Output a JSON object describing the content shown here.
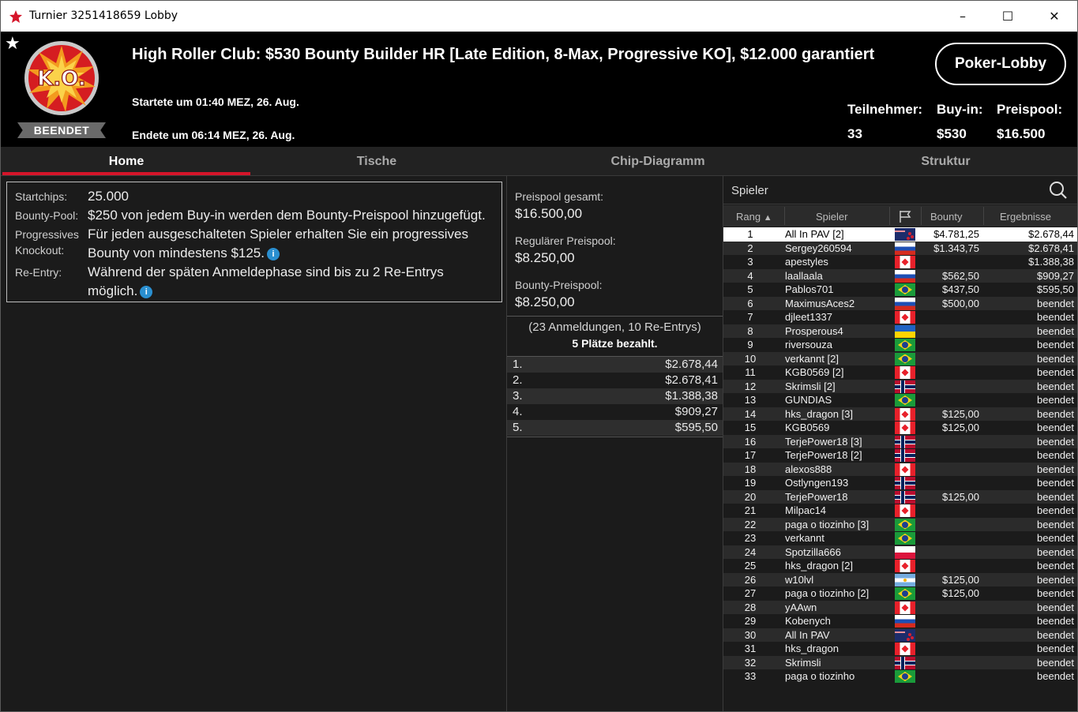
{
  "window": {
    "title": "Turnier 3251418659 Lobby",
    "minimize": "–",
    "maximize": "☐",
    "close": "✕"
  },
  "header": {
    "title": "High Roller Club: $530 Bounty Builder HR [Late Edition, 8-Max, Progressive KO], $12.000 garantiert",
    "logo_text": "K.O.",
    "status": "BEENDET",
    "started": "Startete um 01:40 MEZ, 26. Aug.",
    "ended": "Endete um 06:14 MEZ, 26. Aug.",
    "lobby_button": "Poker-Lobby",
    "stats": {
      "participants_label": "Teilnehmer:",
      "participants_value": "33",
      "buyin_label": "Buy-in:",
      "buyin_value": "$530",
      "prizepool_label": "Preispool:",
      "prizepool_value": "$16.500"
    }
  },
  "tabs": [
    {
      "label": "Home",
      "active": true
    },
    {
      "label": "Tische",
      "active": false
    },
    {
      "label": "Chip-Diagramm",
      "active": false
    },
    {
      "label": "Struktur",
      "active": false
    }
  ],
  "info": {
    "startchips_label": "Startchips:",
    "startchips_value": "25.000",
    "bountypool_label": "Bounty-Pool:",
    "bountypool_value": "$250 von jedem Buy-in werden dem Bounty-Preispool hinzugefügt.",
    "pko_label_1": "Progressives",
    "pko_label_2": "Knockout:",
    "pko_value_1": "Für jeden ausgeschalteten Spieler erhalten Sie ein progressives",
    "pko_value_2": "Bounty von mindestens $125.",
    "reentry_label": "Re-Entry:",
    "reentry_value_1": "Während der späten Anmeldephase sind bis zu 2 Re-Entrys",
    "reentry_value_2": "möglich."
  },
  "prize": {
    "total_label": "Preispool gesamt:",
    "total_value": "$16.500,00",
    "regular_label": "Regulärer Preispool:",
    "regular_value": "$8.250,00",
    "bounty_label": "Bounty-Preispool:",
    "bounty_value": "$8.250,00",
    "entries": "(23 Anmeldungen, 10 Re-Entrys)",
    "paid": "5 Plätze bezahlt.",
    "payouts": [
      {
        "place": "1.",
        "amount": "$2.678,44"
      },
      {
        "place": "2.",
        "amount": "$2.678,41"
      },
      {
        "place": "3.",
        "amount": "$1.388,38"
      },
      {
        "place": "4.",
        "amount": "$909,27"
      },
      {
        "place": "5.",
        "amount": "$595,50"
      }
    ]
  },
  "players": {
    "search_label": "Spieler",
    "columns": {
      "rank": "Rang",
      "player": "Spieler",
      "bounty": "Bounty",
      "result": "Ergebnisse"
    },
    "rows": [
      {
        "rank": "1",
        "name": "All In PAV [2]",
        "flag": "nz",
        "bounty": "$4.781,25",
        "result": "$2.678,44"
      },
      {
        "rank": "2",
        "name": "Sergey260594",
        "flag": "ru",
        "bounty": "$1.343,75",
        "result": "$2.678,41"
      },
      {
        "rank": "3",
        "name": "apestyles",
        "flag": "ca",
        "bounty": "",
        "result": "$1.388,38"
      },
      {
        "rank": "4",
        "name": "laallaala",
        "flag": "ru",
        "bounty": "$562,50",
        "result": "$909,27"
      },
      {
        "rank": "5",
        "name": "Pablos701",
        "flag": "br",
        "bounty": "$437,50",
        "result": "$595,50"
      },
      {
        "rank": "6",
        "name": "MaximusAces2",
        "flag": "ru",
        "bounty": "$500,00",
        "result": "beendet"
      },
      {
        "rank": "7",
        "name": "djleet1337",
        "flag": "ca",
        "bounty": "",
        "result": "beendet"
      },
      {
        "rank": "8",
        "name": "Prosperous4",
        "flag": "ua",
        "bounty": "",
        "result": "beendet"
      },
      {
        "rank": "9",
        "name": "riversouza",
        "flag": "br",
        "bounty": "",
        "result": "beendet"
      },
      {
        "rank": "10",
        "name": "verkannt [2]",
        "flag": "br",
        "bounty": "",
        "result": "beendet"
      },
      {
        "rank": "11",
        "name": "KGB0569 [2]",
        "flag": "ca",
        "bounty": "",
        "result": "beendet"
      },
      {
        "rank": "12",
        "name": "Skrimsli [2]",
        "flag": "no",
        "bounty": "",
        "result": "beendet"
      },
      {
        "rank": "13",
        "name": "GUNDIAS",
        "flag": "br",
        "bounty": "",
        "result": "beendet"
      },
      {
        "rank": "14",
        "name": "hks_dragon [3]",
        "flag": "ca",
        "bounty": "$125,00",
        "result": "beendet"
      },
      {
        "rank": "15",
        "name": "KGB0569",
        "flag": "ca",
        "bounty": "$125,00",
        "result": "beendet"
      },
      {
        "rank": "16",
        "name": "TerjePower18 [3]",
        "flag": "no",
        "bounty": "",
        "result": "beendet"
      },
      {
        "rank": "17",
        "name": "TerjePower18 [2]",
        "flag": "no",
        "bounty": "",
        "result": "beendet"
      },
      {
        "rank": "18",
        "name": "alexos888",
        "flag": "ca",
        "bounty": "",
        "result": "beendet"
      },
      {
        "rank": "19",
        "name": "Ostlyngen193",
        "flag": "no",
        "bounty": "",
        "result": "beendet"
      },
      {
        "rank": "20",
        "name": "TerjePower18",
        "flag": "no",
        "bounty": "$125,00",
        "result": "beendet"
      },
      {
        "rank": "21",
        "name": "Milpac14",
        "flag": "ca",
        "bounty": "",
        "result": "beendet"
      },
      {
        "rank": "22",
        "name": "paga o tiozinho [3]",
        "flag": "br",
        "bounty": "",
        "result": "beendet"
      },
      {
        "rank": "23",
        "name": "verkannt",
        "flag": "br",
        "bounty": "",
        "result": "beendet"
      },
      {
        "rank": "24",
        "name": "Spotzilla666",
        "flag": "pl",
        "bounty": "",
        "result": "beendet"
      },
      {
        "rank": "25",
        "name": "hks_dragon [2]",
        "flag": "ca",
        "bounty": "",
        "result": "beendet"
      },
      {
        "rank": "26",
        "name": "w10lvl",
        "flag": "ar",
        "bounty": "$125,00",
        "result": "beendet"
      },
      {
        "rank": "27",
        "name": "paga o tiozinho [2]",
        "flag": "br",
        "bounty": "$125,00",
        "result": "beendet"
      },
      {
        "rank": "28",
        "name": "yAAwn",
        "flag": "ca",
        "bounty": "",
        "result": "beendet"
      },
      {
        "rank": "29",
        "name": "Kobenych",
        "flag": "ru",
        "bounty": "",
        "result": "beendet"
      },
      {
        "rank": "30",
        "name": "All In PAV",
        "flag": "nz",
        "bounty": "",
        "result": "beendet"
      },
      {
        "rank": "31",
        "name": "hks_dragon",
        "flag": "ca",
        "bounty": "",
        "result": "beendet"
      },
      {
        "rank": "32",
        "name": "Skrimsli",
        "flag": "no",
        "bounty": "",
        "result": "beendet"
      },
      {
        "rank": "33",
        "name": "paga o tiozinho",
        "flag": "br",
        "bounty": "",
        "result": "beendet"
      }
    ]
  }
}
